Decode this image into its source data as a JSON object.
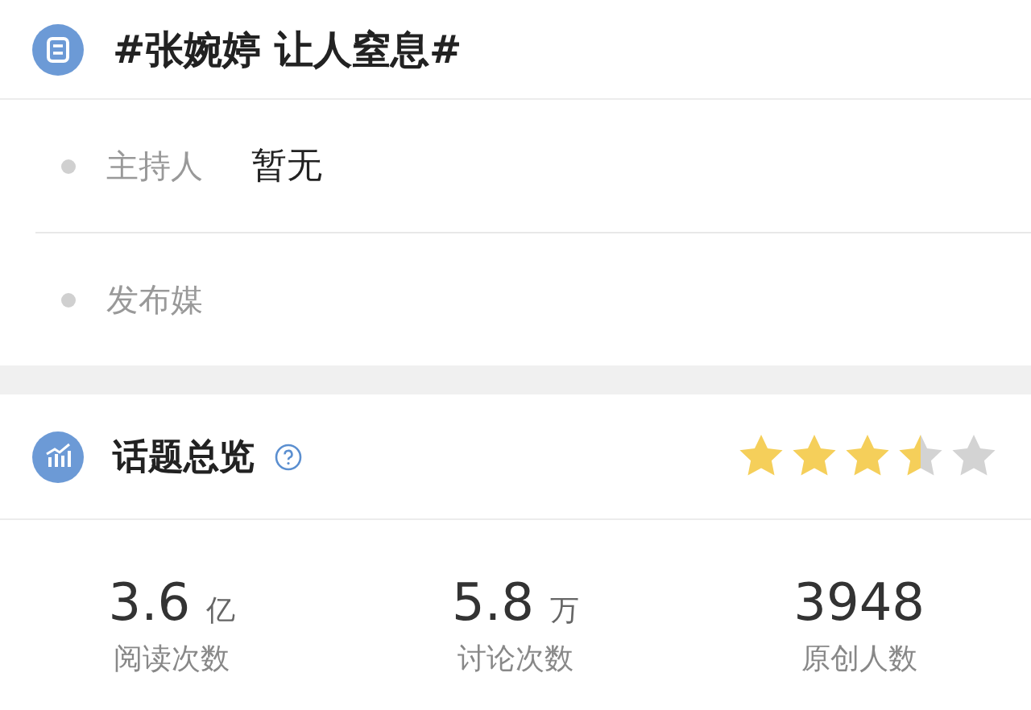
{
  "topic": {
    "title": "#张婉婷 让人窒息#"
  },
  "info_rows": [
    {
      "label": "主持人",
      "value": "暂无"
    },
    {
      "label": "发布媒"
    }
  ],
  "overview": {
    "title": "话题总览",
    "stars": 3.5
  },
  "stats": [
    {
      "value": "3.6",
      "unit": "亿",
      "label": "阅读次数"
    },
    {
      "value": "5.8",
      "unit": "万",
      "label": "讨论次数"
    },
    {
      "value": "3948",
      "label": "原创人数"
    }
  ]
}
